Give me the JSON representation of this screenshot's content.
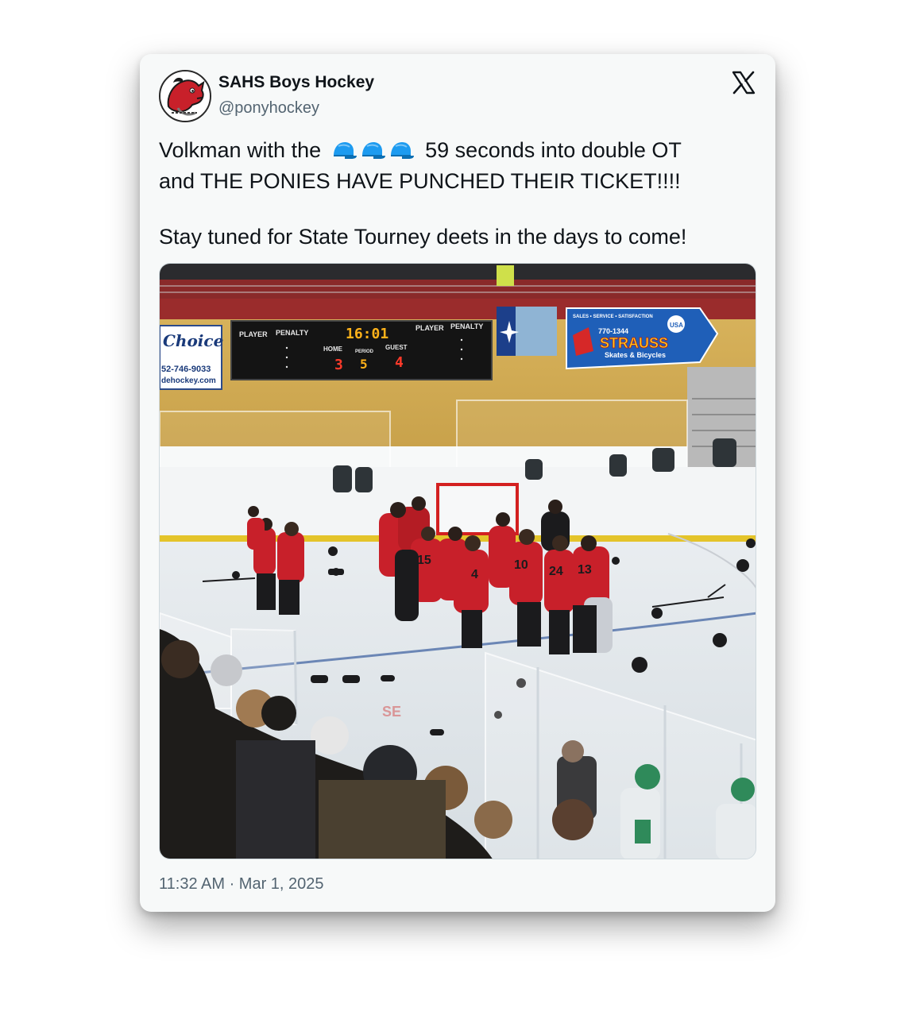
{
  "author": {
    "name": "SAHS Boys Hockey",
    "handle": "@ponyhockey",
    "avatar_icon": "red-pony-mascot-icon"
  },
  "platform_icon": "x-logo-icon",
  "tweet": {
    "line1_before": "Volkman with the",
    "hat_trick_emoji": "🧢🧢🧢",
    "line1_after": "59 seconds into double OT",
    "line2": "and THE PONIES HAVE PUNCHED THEIR TICKET!!!!",
    "line3": "Stay tuned for State Tourney deets in the days to come!"
  },
  "media": {
    "scoreboard": {
      "player_left": "PLAYER",
      "penalty_left": "PENALTY",
      "player_right": "PLAYER",
      "penalty_right": "PENALTY",
      "clock": "16:01",
      "home_label": "HOME",
      "period_label": "PERIOD",
      "guest_label": "GUEST",
      "home_score": "3",
      "period": "5",
      "guest_score": "4"
    },
    "ad_left": {
      "brand": "Choice",
      "phone": "52-746-9033",
      "site": "dehockey.com"
    },
    "ad_right": {
      "top_line": "SALES • SERVICE • SATISFACTION",
      "phone": "770-1344",
      "brand": "STRAUSS",
      "tagline": "Skates & Bicycles",
      "badge": "USA"
    },
    "jersey_numbers": [
      "15",
      "4",
      "10",
      "24",
      "13"
    ]
  },
  "timestamp": "11:32 AM · Mar 1, 2025",
  "colors": {
    "card_bg": "#f7f9f9",
    "text_primary": "#0f1419",
    "text_secondary": "#536471",
    "cap_blue": "#1d9bf0",
    "team_red": "#c8202a"
  }
}
